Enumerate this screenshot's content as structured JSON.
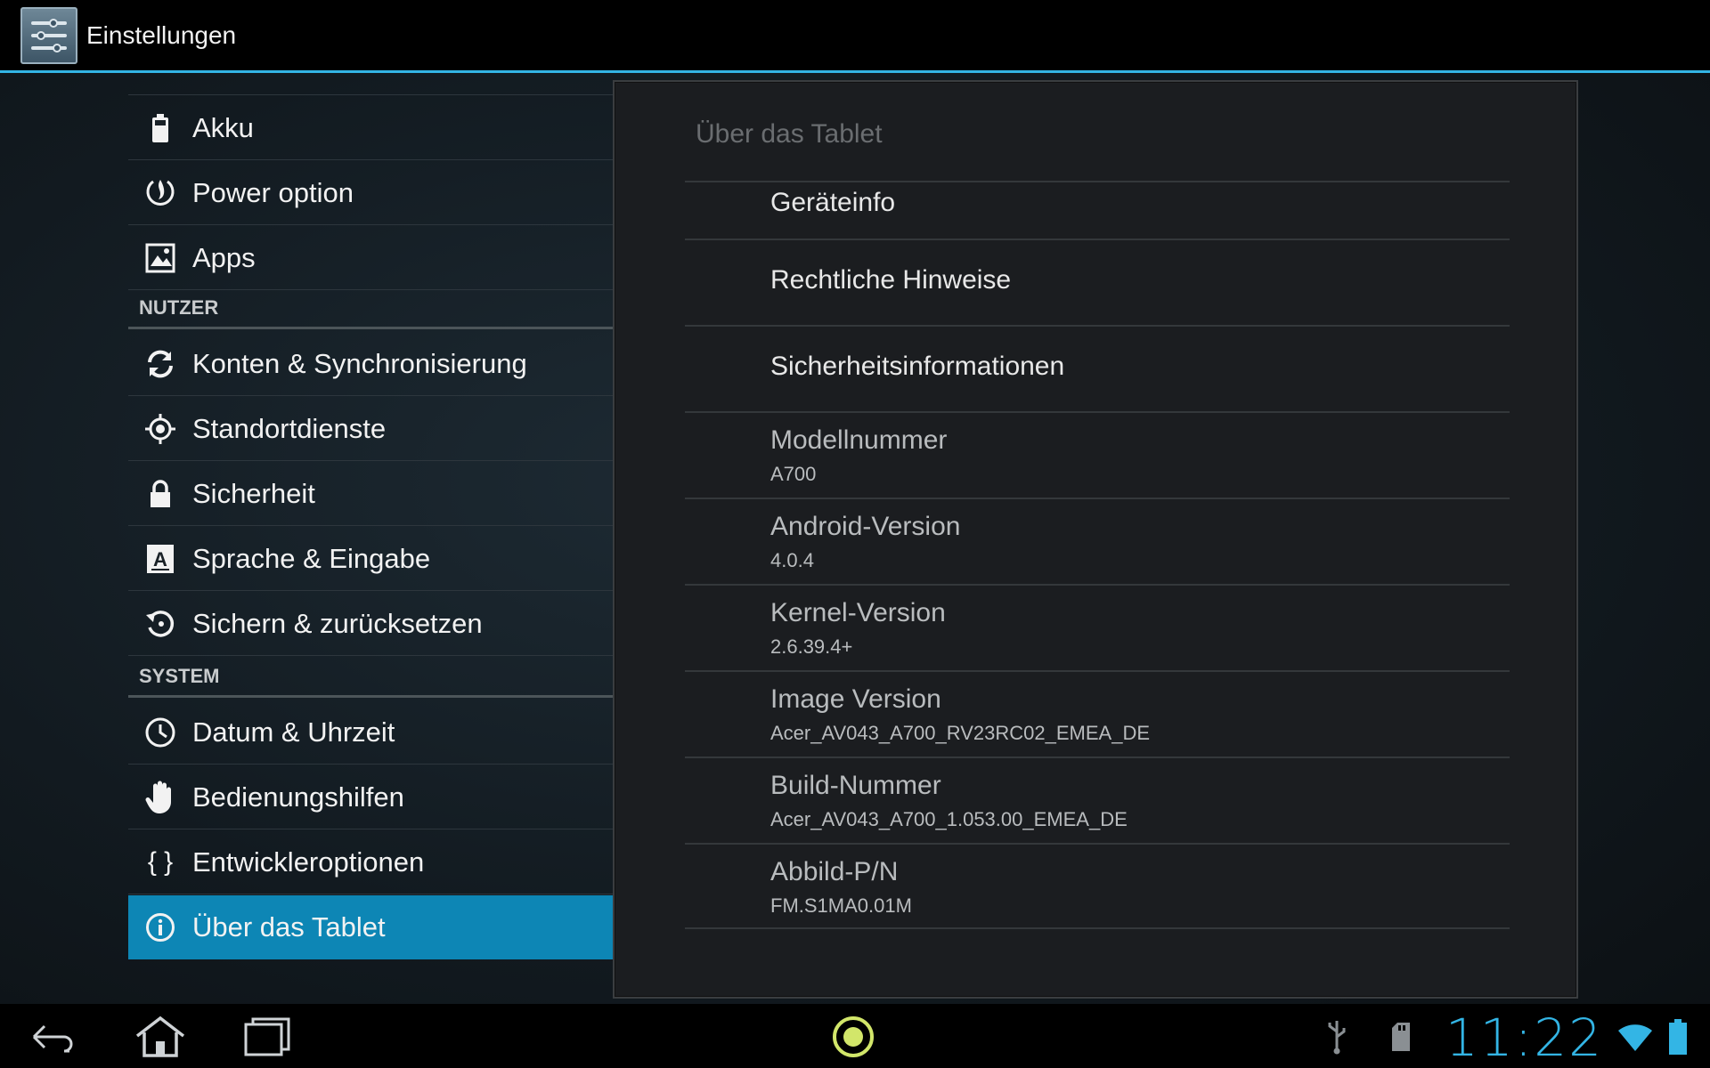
{
  "action_bar": {
    "title": "Einstellungen",
    "icon": "settings-sliders-icon"
  },
  "left_list": {
    "items_top": [
      {
        "label": "Akku",
        "icon": "battery-icon"
      },
      {
        "label": "Power option",
        "icon": "power-flame-icon"
      },
      {
        "label": "Apps",
        "icon": "apps-icon"
      }
    ],
    "section_user": "NUTZER",
    "items_user": [
      {
        "label": "Konten & Synchronisierung",
        "icon": "sync-icon"
      },
      {
        "label": "Standortdienste",
        "icon": "location-icon"
      },
      {
        "label": "Sicherheit",
        "icon": "lock-icon"
      },
      {
        "label": "Sprache & Eingabe",
        "icon": "language-icon"
      },
      {
        "label": "Sichern & zurücksetzen",
        "icon": "backup-icon"
      }
    ],
    "section_system": "SYSTEM",
    "items_system": [
      {
        "label": "Datum & Uhrzeit",
        "icon": "clock-icon"
      },
      {
        "label": "Bedienungshilfen",
        "icon": "hand-icon"
      },
      {
        "label": "Entwickleroptionen",
        "icon": "braces-icon",
        "glyph": "{ }"
      },
      {
        "label": "Über das Tablet",
        "icon": "info-icon",
        "selected": true
      }
    ]
  },
  "panel": {
    "title": "Über das Tablet",
    "links": [
      {
        "label": "Geräteinfo"
      },
      {
        "label": "Rechtliche Hinweise"
      },
      {
        "label": "Sicherheitsinformationen"
      }
    ],
    "info": [
      {
        "label": "Modellnummer",
        "value": "A700"
      },
      {
        "label": "Android-Version",
        "value": "4.0.4"
      },
      {
        "label": "Kernel-Version",
        "value": "2.6.39.4+"
      },
      {
        "label": "Image Version",
        "value": "Acer_AV043_A700_RV23RC02_EMEA_DE"
      },
      {
        "label": "Build-Nummer",
        "value": "Acer_AV043_A700_1.053.00_EMEA_DE"
      },
      {
        "label": "Abbild-P/N",
        "value": "FM.S1MA0.01M"
      }
    ]
  },
  "nav_bar": {
    "clock": "11:22",
    "accent_color": "#33b5e5",
    "selected_color": "#0d86b5"
  }
}
